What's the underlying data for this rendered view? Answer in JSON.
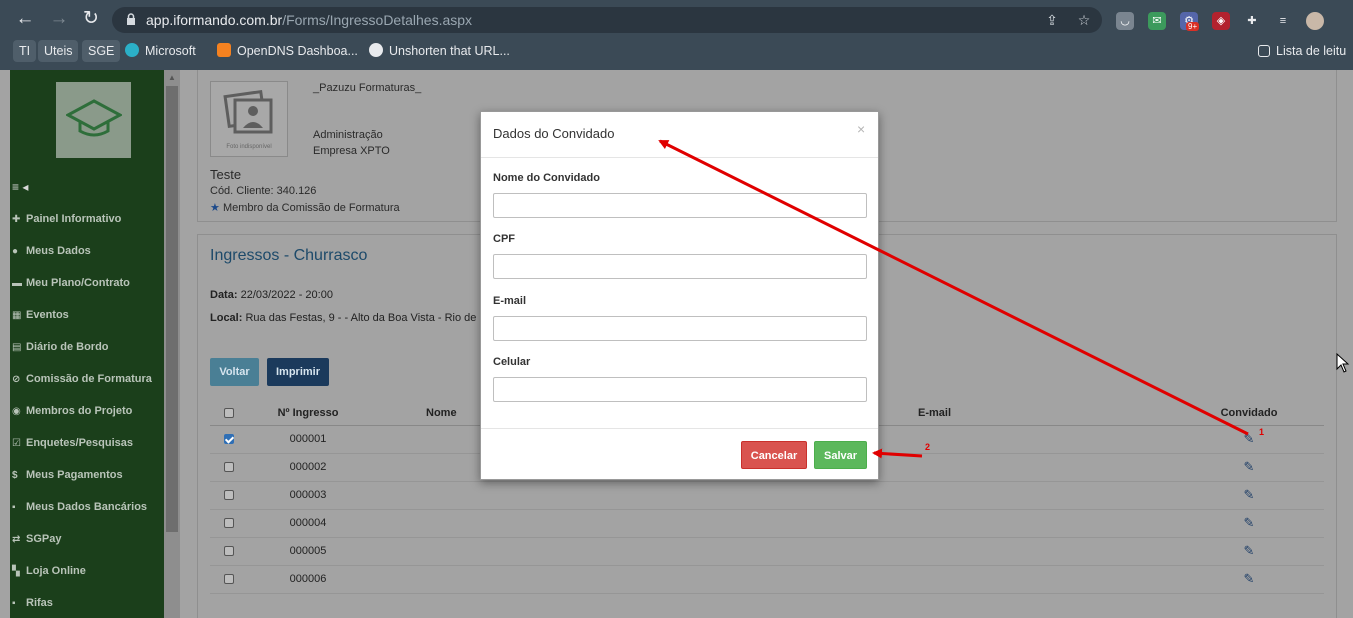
{
  "browser": {
    "url_domain": "app.iformando.com.br",
    "url_path": "/Forms/IngressoDetalhes.aspx",
    "extension_badge": "9+",
    "bookmarks": [
      "TI",
      "Uteis",
      "SGE",
      "Microsoft",
      "OpenDNS Dashboa...",
      "Unshorten that URL..."
    ],
    "reading_list": "Lista de leitu"
  },
  "sidebar": {
    "items": [
      {
        "icon": "✚",
        "label": "Painel Informativo"
      },
      {
        "icon": "●",
        "label": "Meus Dados"
      },
      {
        "icon": "▬",
        "label": "Meu Plano/Contrato"
      },
      {
        "icon": "▦",
        "label": "Eventos"
      },
      {
        "icon": "▤",
        "label": "Diário de Bordo"
      },
      {
        "icon": "⊘",
        "label": "Comissão de Formatura"
      },
      {
        "icon": "◉",
        "label": "Membros do Projeto"
      },
      {
        "icon": "☑",
        "label": "Enquetes/Pesquisas"
      },
      {
        "icon": "$",
        "label": "Meus Pagamentos"
      },
      {
        "icon": "▪",
        "label": "Meus Dados Bancários"
      },
      {
        "icon": "⇄",
        "label": "SGPay"
      },
      {
        "icon": "▚",
        "label": "Loja Online"
      },
      {
        "icon": "▪",
        "label": "Rifas"
      }
    ]
  },
  "profile": {
    "org": "_Pazuzu Formaturas_",
    "photo_caption": "Foto indisponível",
    "role": "Administração",
    "company": "Empresa XPTO",
    "name": "Teste",
    "client_code_label": "Cód. Cliente:",
    "client_code": "340.126",
    "member_label": "Membro da Comissão de Formatura"
  },
  "tickets": {
    "title": "Ingressos - Churrasco",
    "date_label": "Data:",
    "date_value": "22/03/2022 - 20:00",
    "local_label": "Local:",
    "local_value": "Rua das Festas, 9 - - Alto da Boa Vista - Rio de",
    "btn_back": "Voltar",
    "btn_print": "Imprimir",
    "columns": {
      "number": "Nº Ingresso",
      "name": "Nome",
      "email": "E-mail",
      "guest": "Convidado"
    },
    "rows": [
      {
        "number": "000001",
        "checked": true
      },
      {
        "number": "000002",
        "checked": false
      },
      {
        "number": "000003",
        "checked": false
      },
      {
        "number": "000004",
        "checked": false
      },
      {
        "number": "000005",
        "checked": false
      },
      {
        "number": "000006",
        "checked": false
      }
    ]
  },
  "modal": {
    "title": "Dados do Convidado",
    "close": "×",
    "fields": {
      "name_label": "Nome do Convidado",
      "cpf_label": "CPF",
      "email_label": "E-mail",
      "phone_label": "Celular",
      "name_value": "",
      "cpf_value": "",
      "email_value": "",
      "phone_value": ""
    },
    "cancel_label": "Cancelar",
    "save_label": "Salvar"
  },
  "annotations": {
    "marker_1": "1",
    "marker_2": "2",
    "color": "#e00000"
  }
}
